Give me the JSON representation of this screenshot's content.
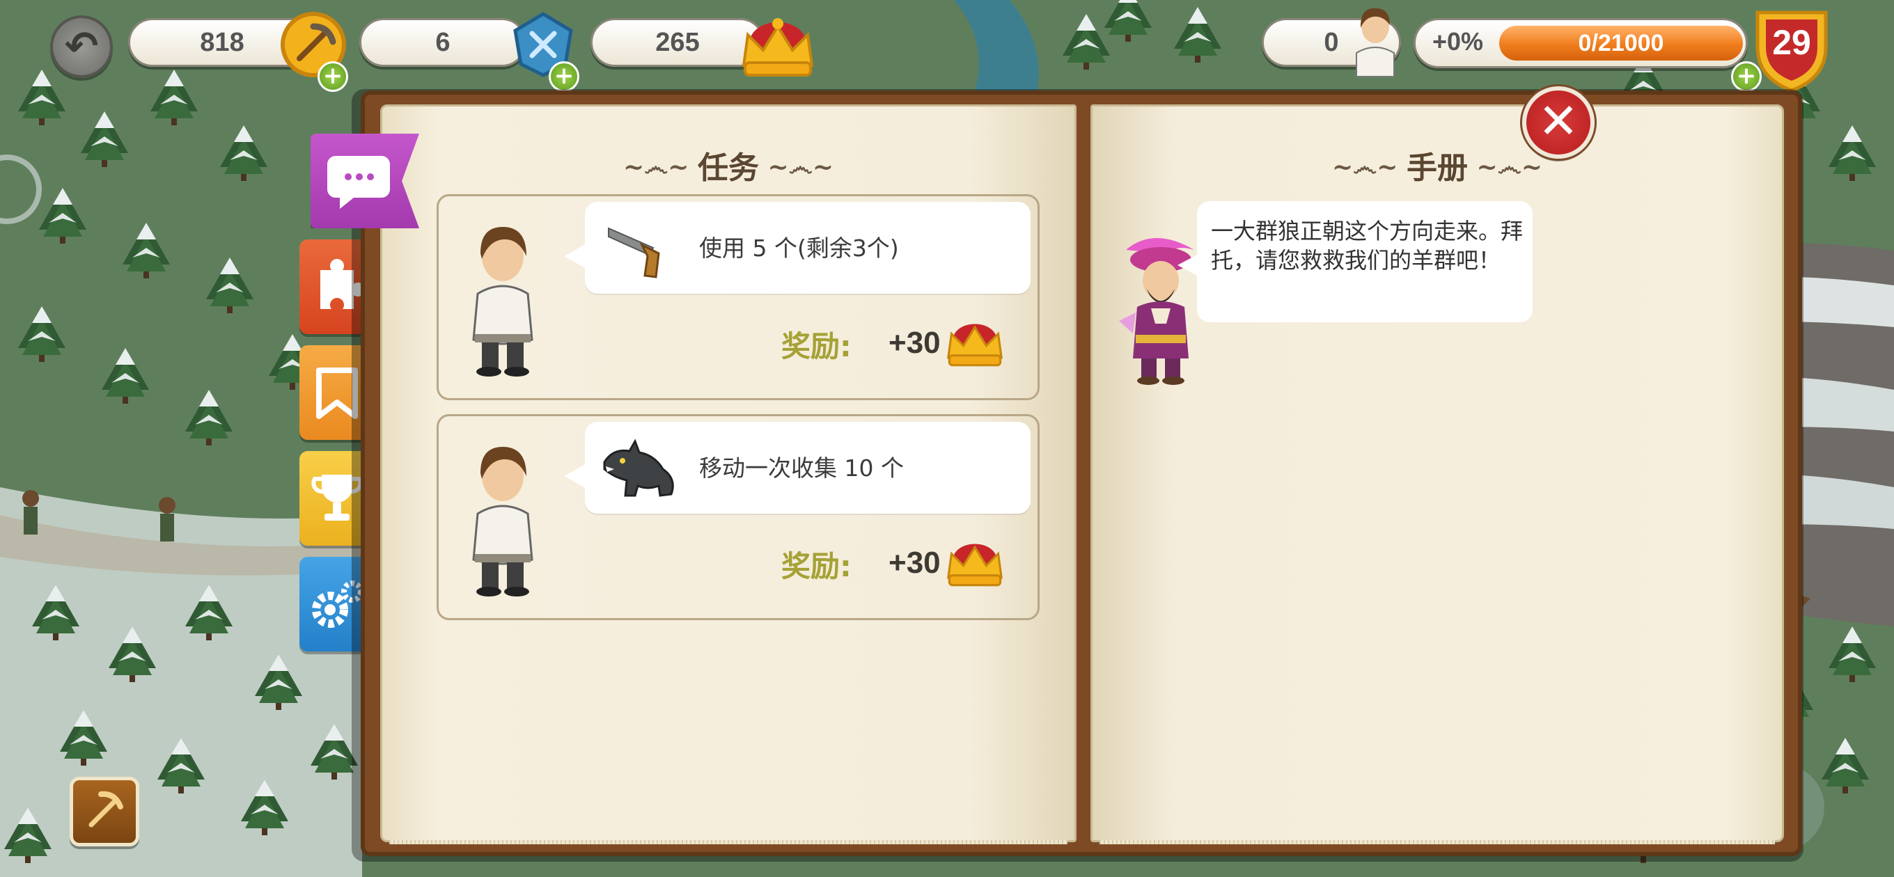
{
  "hud": {
    "resource_1": {
      "value": "818",
      "icon": "pickaxe-coin-icon"
    },
    "resource_2": {
      "value": "6",
      "icon": "blue-gem-icon"
    },
    "crowns": {
      "value": "265",
      "icon": "crown-icon"
    },
    "population": {
      "value": "0",
      "icon": "villager-icon"
    },
    "xp": {
      "percent_text": "+0%",
      "progress_text": "0/21000",
      "progress": 0
    },
    "level": "29"
  },
  "tabs": [
    {
      "name": "chat",
      "color": "#b84bc0"
    },
    {
      "name": "puzzle",
      "color": "#e2552d"
    },
    {
      "name": "bookmark",
      "color": "#f29a2e"
    },
    {
      "name": "trophy",
      "color": "#f3bf2c"
    },
    {
      "name": "settings",
      "color": "#2f8fd4"
    }
  ],
  "quests": {
    "title": "任务",
    "items": [
      {
        "icon": "pistol-icon",
        "text": "使用 5 个(剩余3个)",
        "reward_label": "奖励:",
        "reward_value": "+30"
      },
      {
        "icon": "wolf-icon",
        "text": "移动一次收集 10 个",
        "reward_label": "奖励:",
        "reward_value": "+30"
      }
    ]
  },
  "handbook": {
    "title": "手册",
    "message": "一大群狼正朝这个方向走来。拜托，请您救救我们的羊群吧！"
  },
  "colors": {
    "book_cover": "#7d4a24",
    "page": "#f5eddb",
    "reward_label": "#a5a236",
    "close_button": "#c82828",
    "xp_fill": "#f07d1c"
  }
}
